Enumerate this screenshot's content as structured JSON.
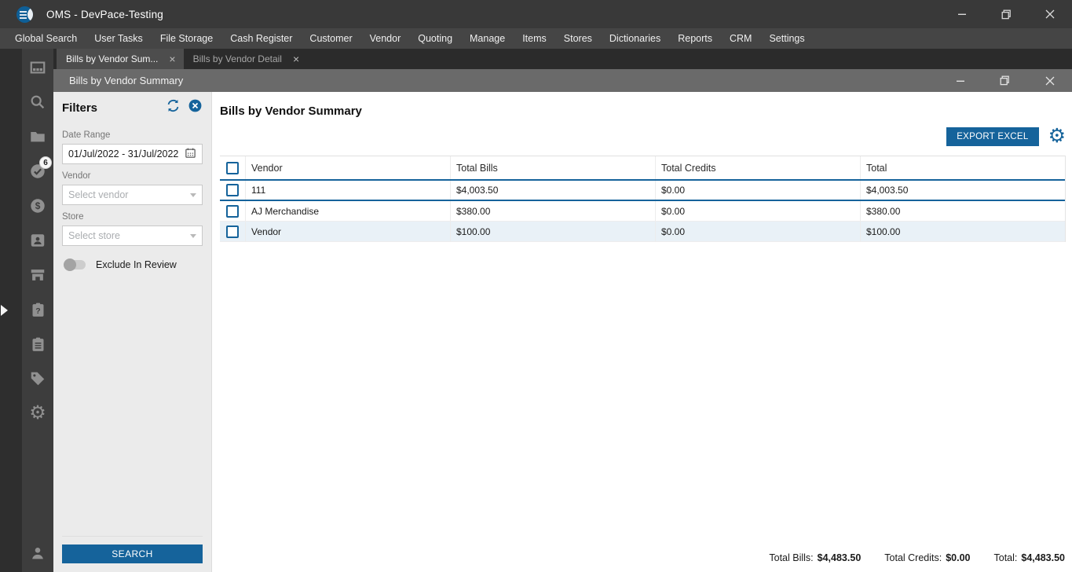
{
  "window": {
    "title": "OMS - DevPace-Testing",
    "controls": [
      "minimize",
      "restore",
      "close"
    ]
  },
  "menu": {
    "items": [
      "Global Search",
      "User Tasks",
      "File Storage",
      "Cash Register",
      "Customer",
      "Vendor",
      "Quoting",
      "Manage",
      "Items",
      "Stores",
      "Dictionaries",
      "Reports",
      "CRM",
      "Settings"
    ]
  },
  "tabs": [
    {
      "label": "Bills by Vendor Sum...",
      "active": true
    },
    {
      "label": "Bills by Vendor Detail",
      "active": false
    }
  ],
  "inner_window": {
    "title": "Bills by Vendor Summary",
    "controls": [
      "minimize",
      "restore",
      "close"
    ]
  },
  "sidebar": {
    "icons": [
      "dashboard-icon",
      "search-icon",
      "folder-icon",
      "tasks-check-icon",
      "money-icon",
      "contact-icon",
      "store-icon",
      "clipboard-question-icon",
      "clipboard-list-icon",
      "tag-icon",
      "gear-icon"
    ],
    "badge_count": "6",
    "bottom_icon": "user-icon",
    "expander": "panel-expander-arrow"
  },
  "filters": {
    "title": "Filters",
    "icons": [
      "refresh-icon",
      "clear-filters-icon"
    ],
    "date_range": {
      "label": "Date Range",
      "value": "01/Jul/2022 - 31/Jul/2022",
      "icon": "calendar-icon"
    },
    "vendor": {
      "label": "Vendor",
      "placeholder": "Select vendor"
    },
    "store": {
      "label": "Store",
      "placeholder": "Select store"
    },
    "exclude_toggle": {
      "label": "Exclude In Review",
      "state": "off"
    },
    "search_label": "SEARCH"
  },
  "main": {
    "title": "Bills by Vendor Summary",
    "export_label": "EXPORT EXCEL",
    "settings_icon": "gear-icon",
    "table": {
      "columns": [
        "Vendor",
        "Total Bills",
        "Total Credits",
        "Total"
      ],
      "rows": [
        {
          "cells": [
            "111",
            "$4,003.50",
            "$0.00",
            "$4,003.50"
          ],
          "selected": true,
          "checked": false
        },
        {
          "cells": [
            "AJ Merchandise",
            "$380.00",
            "$0.00",
            "$380.00"
          ],
          "selected": false,
          "checked": false
        },
        {
          "cells": [
            "Vendor",
            "$100.00",
            "$0.00",
            "$100.00"
          ],
          "selected": false,
          "checked": false
        }
      ]
    },
    "footer": {
      "total_bills_label": "Total Bills:",
      "total_bills_value": "$4,483.50",
      "total_credits_label": "Total Credits:",
      "total_credits_value": "$0.00",
      "total_label": "Total:",
      "total_value": "$4,483.50"
    }
  },
  "colors": {
    "accent": "#15639b",
    "titlebar": "#393939",
    "menubar": "#454545",
    "tabbar": "#2b2b2b",
    "inner_titlebar": "#6a6a6a",
    "sidebar": "#3d3d3d",
    "filter_panel": "#ebebeb",
    "row_alt": "#e9f1f7"
  }
}
